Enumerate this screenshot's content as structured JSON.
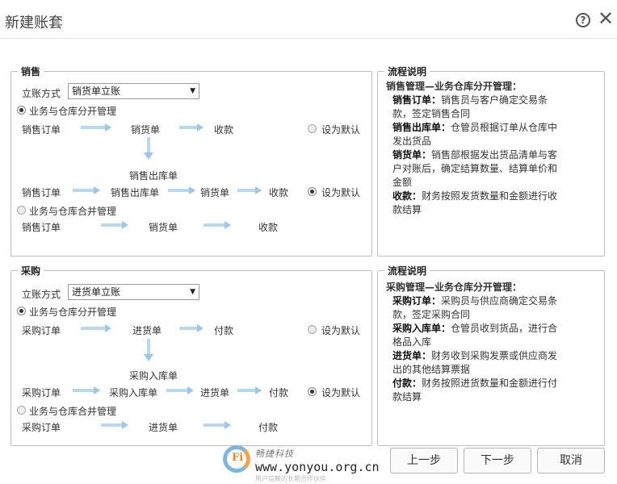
{
  "dialog": {
    "title": "新建账套"
  },
  "sales": {
    "legend": "销售",
    "mode_label": "立账方式",
    "mode_value": "销货单立账",
    "option_separate": "业务与仓库分开管理",
    "option_merged": "业务与仓库合并管理",
    "set_default": "设为默认",
    "flow_a": [
      "销售订单",
      "销货单",
      "收款"
    ],
    "mid_label": "销售出库单",
    "flow_b": [
      "销售订单",
      "销售出库单",
      "销货单",
      "收款"
    ],
    "flow_c": [
      "销售订单",
      "销货单",
      "收款"
    ]
  },
  "sales_desc": {
    "legend": "流程说明",
    "heading": "销售管理—业务仓库分开管理：",
    "items": [
      {
        "term": "销售订单：",
        "text": "销售员与客户确定交易条款，签定销售合同"
      },
      {
        "term": "销售出库单：",
        "text": "仓管员根据订单从仓库中发出货品"
      },
      {
        "term": "销货单：",
        "text": "销售部根据发出货品清单与客户对账后，确定结算数量、结算单价和金额"
      },
      {
        "term": "收款：",
        "text": "财务按照发货数量和金额进行收款结算"
      }
    ]
  },
  "purchase": {
    "legend": "采购",
    "mode_label": "立账方式",
    "mode_value": "进货单立账",
    "option_separate": "业务与仓库分开管理",
    "option_merged": "业务与仓库合并管理",
    "set_default": "设为默认",
    "flow_a": [
      "采购订单",
      "进货单",
      "付款"
    ],
    "mid_label": "采购入库单",
    "flow_b": [
      "采购订单",
      "采购入库单",
      "进货单",
      "付款"
    ],
    "flow_c": [
      "采购订单",
      "进货单",
      "付款"
    ]
  },
  "purchase_desc": {
    "legend": "流程说明",
    "heading": "采购管理—业务仓库分开管理：",
    "items": [
      {
        "term": "采购订单：",
        "text": "采购员与供应商确定交易条款，签定采购合同"
      },
      {
        "term": "采购入库单：",
        "text": "仓管员收到货品，进行合格品入库"
      },
      {
        "term": "进货单：",
        "text": "财务收到采购发票或供应商发出的其他结算票据"
      },
      {
        "term": "付款：",
        "text": "财务按照进货数量和金额进行付款结算"
      }
    ]
  },
  "buttons": {
    "prev": "上一步",
    "next": "下一步",
    "cancel": "取消"
  },
  "watermark": {
    "logo_letter": "Fi",
    "brand": "畅捷科技",
    "url": "www.yonyou.org.cn",
    "tagline": "用户信赖的长期合作伙伴"
  }
}
